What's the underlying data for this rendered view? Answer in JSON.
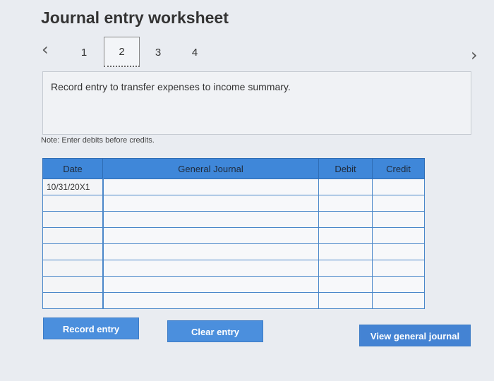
{
  "page": {
    "title": "Journal entry worksheet"
  },
  "nav": {
    "prev_icon": "chevron-left-icon",
    "next_icon": "chevron-right-icon",
    "steps": [
      {
        "label": "1"
      },
      {
        "label": "2",
        "active": true
      },
      {
        "label": "3"
      },
      {
        "label": "4"
      }
    ]
  },
  "instruction": "Record entry to transfer expenses to income summary.",
  "note": "Note: Enter debits before credits.",
  "table": {
    "headers": {
      "date": "Date",
      "account": "General Journal",
      "debit": "Debit",
      "credit": "Credit"
    },
    "rows": [
      {
        "date": "10/31/20X1",
        "account": "",
        "debit": "",
        "credit": ""
      },
      {
        "date": "",
        "account": "",
        "debit": "",
        "credit": ""
      },
      {
        "date": "",
        "account": "",
        "debit": "",
        "credit": ""
      },
      {
        "date": "",
        "account": "",
        "debit": "",
        "credit": ""
      },
      {
        "date": "",
        "account": "",
        "debit": "",
        "credit": ""
      },
      {
        "date": "",
        "account": "",
        "debit": "",
        "credit": ""
      },
      {
        "date": "",
        "account": "",
        "debit": "",
        "credit": ""
      },
      {
        "date": "",
        "account": "",
        "debit": "",
        "credit": ""
      }
    ]
  },
  "buttons": {
    "record": "Record entry",
    "clear": "Clear entry",
    "view": "View general journal"
  },
  "colors": {
    "header_bg": "#3f87d9",
    "button_bg": "#4b8fdd"
  }
}
